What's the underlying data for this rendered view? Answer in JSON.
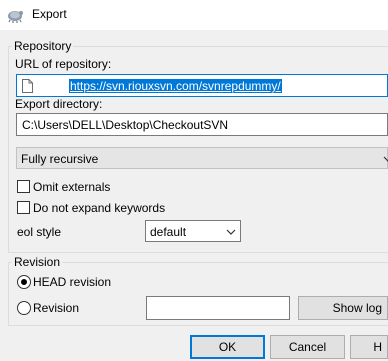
{
  "window": {
    "title": "Export",
    "icon": "tortoisesvn-icon"
  },
  "repository": {
    "group_label": "Repository",
    "url_label": "URL of repository:",
    "url_value": "https://svn.riouxsvn.com/svnrepdummy/",
    "export_dir_label": "Export directory:",
    "export_dir_value": "C:\\Users\\DELL\\Desktop\\CheckoutSVN",
    "depth_value": "Fully recursive",
    "omit_externals_label": "Omit externals",
    "omit_externals_checked": false,
    "no_expand_keywords_label": "Do not expand keywords",
    "no_expand_keywords_checked": false,
    "eol_label": "eol style",
    "eol_value": "default"
  },
  "revision": {
    "group_label": "Revision",
    "head_label": "HEAD revision",
    "head_selected": true,
    "revision_label": "Revision",
    "revision_selected": false,
    "revision_value": "",
    "show_log_label": "Show log"
  },
  "buttons": {
    "ok_label": "OK",
    "cancel_label": "Cancel",
    "help_label": "H"
  },
  "colors": {
    "accent": "#0078d7",
    "background": "#f0f0f0"
  }
}
